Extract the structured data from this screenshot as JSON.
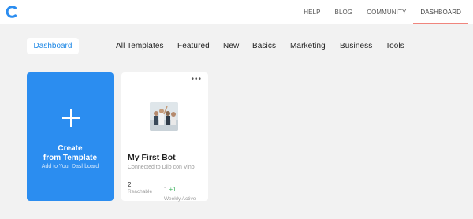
{
  "app": {
    "logo_icon": "app-logo-c-icon",
    "accent_color": "#2b8df0"
  },
  "nav": {
    "items": [
      {
        "label": "HELP"
      },
      {
        "label": "BLOG"
      },
      {
        "label": "COMMUNITY"
      },
      {
        "label": "DASHBOARD"
      }
    ],
    "active": "DASHBOARD",
    "active_underline_color": "#f0857d"
  },
  "filters": {
    "dashboard_label": "Dashboard",
    "categories": [
      "All Templates",
      "Featured",
      "New",
      "Basics",
      "Marketing",
      "Business",
      "Tools"
    ]
  },
  "create_card": {
    "title": "Create\nfrom Template",
    "subtitle": "Add to Your Dashboard",
    "icon": "plus-icon"
  },
  "bot_card": {
    "menu_icon": "more-dots-icon",
    "name": "My First Bot",
    "connection": "Connected to Dilo con Vino",
    "reachable_value": "2",
    "reachable_label": "Reachable",
    "weekly_active_value": "1",
    "weekly_active_delta": "+1",
    "weekly_active_label": "Weekly Active",
    "delta_color": "#43b463"
  }
}
